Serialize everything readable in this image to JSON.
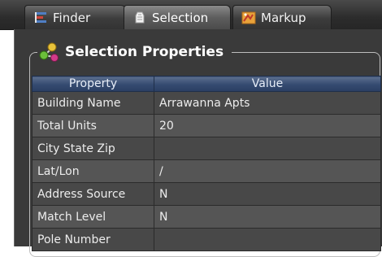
{
  "tabs": [
    {
      "label": "Finder",
      "icon": "finder-icon",
      "active": false
    },
    {
      "label": "Selection",
      "icon": "selection-icon",
      "active": true
    },
    {
      "label": "Markup",
      "icon": "markup-icon",
      "active": false
    }
  ],
  "panel": {
    "title": "Selection Properties",
    "icon": "selection-properties-icon"
  },
  "grid": {
    "headers": {
      "property": "Property",
      "value": "Value"
    },
    "rows": [
      {
        "property": "Building Name",
        "value": "Arrawanna Apts"
      },
      {
        "property": "Total Units",
        "value": "20"
      },
      {
        "property": "City State Zip",
        "value": ""
      },
      {
        "property": "Lat/Lon",
        "value": "/"
      },
      {
        "property": "Address Source",
        "value": "N"
      },
      {
        "property": "Match Level",
        "value": "N"
      },
      {
        "property": "Pole Number",
        "value": ""
      }
    ]
  },
  "colors": {
    "tab_bar": "#2c2c2c",
    "panel_bg": "#3a3a3a",
    "header_blue": "#344a70",
    "row_dark": "#484848",
    "row_light": "#555555"
  }
}
